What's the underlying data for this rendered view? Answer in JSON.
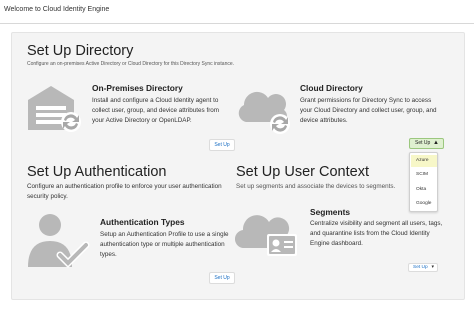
{
  "window": {
    "title": "Welcome to Cloud Identity Engine"
  },
  "directory": {
    "heading": "Set Up Directory",
    "subheading": "Configure an on-premises Active Directory or Cloud Directory for this Directory Sync instance.",
    "on_prem": {
      "title": "On-Premises Directory",
      "description": "Install and configure a Cloud Identity agent to collect user, group, and device attributes from your Active Directory or OpenLDAP.",
      "link": "Set Up"
    },
    "cloud": {
      "title": "Cloud Directory",
      "description": "Grant permissions for Directory Sync to access your Cloud Directory and collect user, group, and device attributes.",
      "dropdown_label": "Set Up",
      "options": [
        "Azure",
        "SCIM",
        "Okta",
        "Google"
      ],
      "selected": "Azure"
    }
  },
  "authentication": {
    "heading": "Set Up Authentication",
    "subheading": "Configure an authentication profile to enforce your user authentication security policy.",
    "card_title": "Authentication Types",
    "description": "Setup an Authentication Profile to use a single authentication type or multiple authentication types.",
    "link": "Set Up"
  },
  "user_context": {
    "heading": "Set Up User Context",
    "subheading": "Set up segments and associate the devices to segments.",
    "card_title": "Segments",
    "description": "Centralize visibility and segment all users, tags, and quarantine lists from the Cloud Identity Engine dashboard.",
    "dropdown_label": "Set Up"
  },
  "colors": {
    "accent_link": "#1a6fc4",
    "dropdown_bg": "#dff0d0",
    "selected_option": "#f7f7c8",
    "icon_gray": "#b8b8b8"
  }
}
